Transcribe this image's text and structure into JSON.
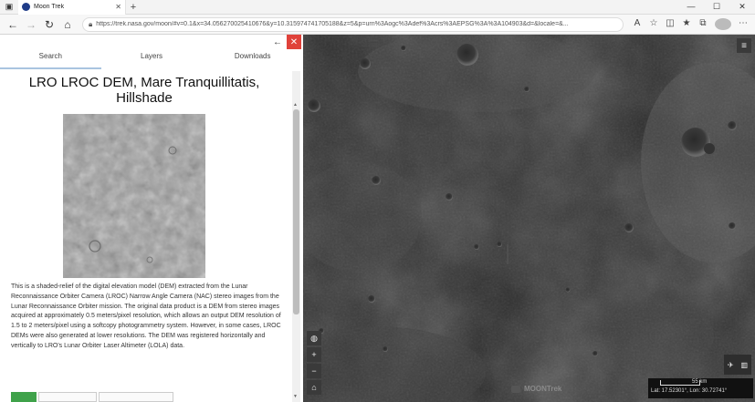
{
  "browser": {
    "tab_title": "Moon Trek",
    "tab_close": "✕",
    "new_tab": "+",
    "url": "https://trek.nasa.gov/moon/#v=0.1&x=34.056270025410676&y=10.315974741705188&z=5&p=urn%3Aogc%3Adef%3Acrs%3AEPSG%3A%3A104903&d=&locale=&..."
  },
  "panel": {
    "tabs": [
      "Search",
      "Layers",
      "Downloads"
    ],
    "title": "LRO LROC DEM, Mare Tranquillitatis, Hillshade",
    "description": "This is a shaded-relief of the digital elevation model (DEM) extracted from the Lunar Reconnaissance Orbiter Camera (LROC) Narrow Angle Camera (NAC) stereo images from the Lunar Reconnaissance Orbiter mission. The original data product is a DEM from stereo images acquired at approximately 0.5 meters/pixel resolution, which allows an output DEM resolution of 1.5 to 2 meters/pixel using a softcopy photogrammetry system. However, in some cases, LROC DEMs were also generated at lower resolutions. The DEM was registered horizontally and vertically to LRO's Lunar Orbiter Laser Altimeter (LOLA) data."
  },
  "map": {
    "brand": "MOONTrek",
    "scale_label": "55 km",
    "coordinates": "Lat: 17.52301°, Lon: 30.72741°"
  },
  "colors": {
    "close_button": "#e0423a",
    "map_background": "#2a2a2a",
    "active_tab_underline": "#a9c4e0"
  }
}
